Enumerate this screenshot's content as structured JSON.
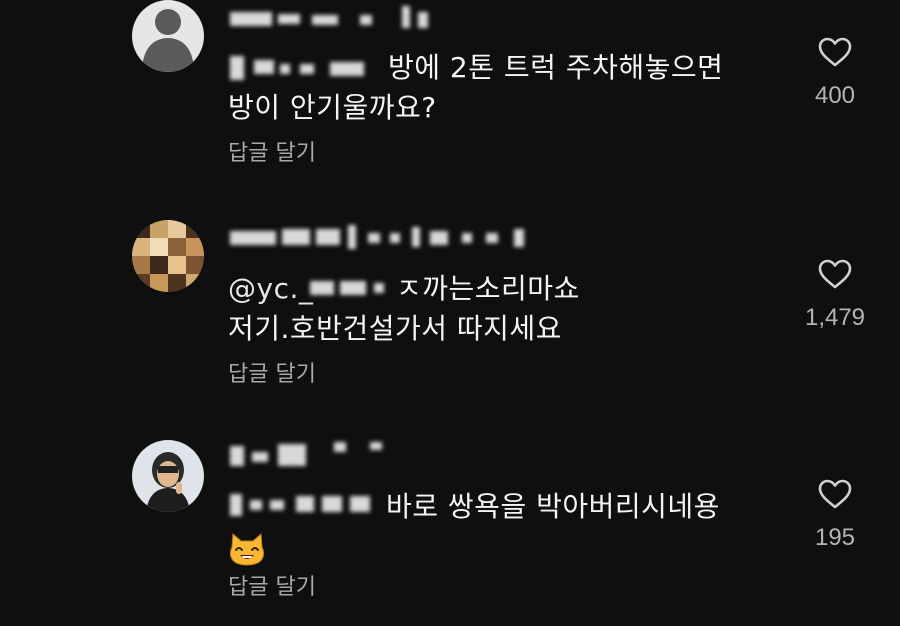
{
  "comments": [
    {
      "text_line1": "방에 2톤 트럭 주차해놓으면",
      "text_line2": "방이 안기울까요?",
      "reply_label": "답글 달기",
      "like_count": "400",
      "avatar": "default-person-avatar"
    },
    {
      "mention_visible": "@yc._ ",
      "text_line1": "ㅈ까는소리마쇼",
      "text_line2": "저기.호반건설가서 따지세요",
      "reply_label": "답글 달기",
      "like_count": "1,479",
      "avatar": "blurred-photo-avatar"
    },
    {
      "text_line1": "바로 쌍욕을 박아버리시네용",
      "emoji": "smiling-cat-emoji",
      "reply_label": "답글 달기",
      "like_count": "195",
      "avatar": "blurred-person-avatar"
    }
  ],
  "icons": {
    "like": "heart-outline-icon"
  },
  "colors": {
    "background": "#0f0f0f",
    "text": "#f1f1f1",
    "secondary_text": "#a8a8a8"
  }
}
